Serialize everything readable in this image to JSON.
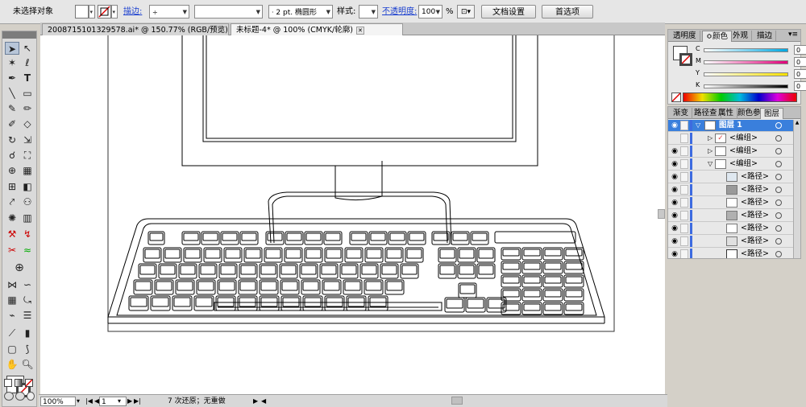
{
  "control_bar": {
    "selection_status": "未选择对象",
    "stroke_label": "描边:",
    "stroke_weight": "",
    "brush_label": "2 pt. 椭圆形",
    "style_label": "样式:",
    "opacity_label": "不透明度:",
    "opacity_value": "100",
    "opacity_unit": "%",
    "doc_setup_button": "文档设置",
    "prefs_button": "首选项"
  },
  "doc_tabs": [
    {
      "label": "2008715101329578.ai* @ 150.77% (RGB/预览)"
    },
    {
      "label": "未标题-4* @ 100% (CMYK/轮廓)"
    }
  ],
  "status_bar": {
    "zoom": "100%",
    "artboard": "1",
    "status_text": "7 次还原；无重做"
  },
  "color_panel": {
    "tabs": [
      "透明度",
      "颜色",
      "外观",
      "描边"
    ],
    "active_tab": "颜色",
    "channels": [
      {
        "name": "C",
        "value": "0",
        "color": "#00a7e1"
      },
      {
        "name": "M",
        "value": "0",
        "color": "#e0007a"
      },
      {
        "name": "Y",
        "value": "0",
        "color": "#f6e000"
      },
      {
        "name": "K",
        "value": "0",
        "color": "#000000"
      }
    ]
  },
  "layers_panel": {
    "tabs": [
      "渐变",
      "路径查",
      "属性",
      "颜色参",
      "图层"
    ],
    "active_tab": "图层",
    "layer_name": "图层 1",
    "groups": [
      "<编组>",
      "<编组>",
      "<编组>"
    ],
    "paths": [
      "<路径>",
      "<路径>",
      "<路径>",
      "<路径>",
      "<路径>",
      "<路径>",
      "<路径>"
    ]
  },
  "icons": [
    "selection-tool-icon",
    "direct-selection-tool-icon",
    "pen-tool-icon",
    "type-tool-icon",
    "line-tool-icon",
    "rectangle-tool-icon",
    "paintbrush-tool-icon",
    "pencil-tool-icon",
    "eraser-tool-icon",
    "rotate-tool-icon",
    "scale-tool-icon",
    "warp-tool-icon",
    "free-transform-tool-icon",
    "symbol-sprayer-tool-icon",
    "column-graph-tool-icon",
    "mesh-tool-icon",
    "gradient-tool-icon",
    "eyedropper-tool-icon",
    "blend-tool-icon",
    "live-paint-tool-icon",
    "artboard-tool-icon",
    "slice-tool-icon",
    "hand-tool-icon",
    "zoom-tool-icon",
    "eye-icon"
  ]
}
